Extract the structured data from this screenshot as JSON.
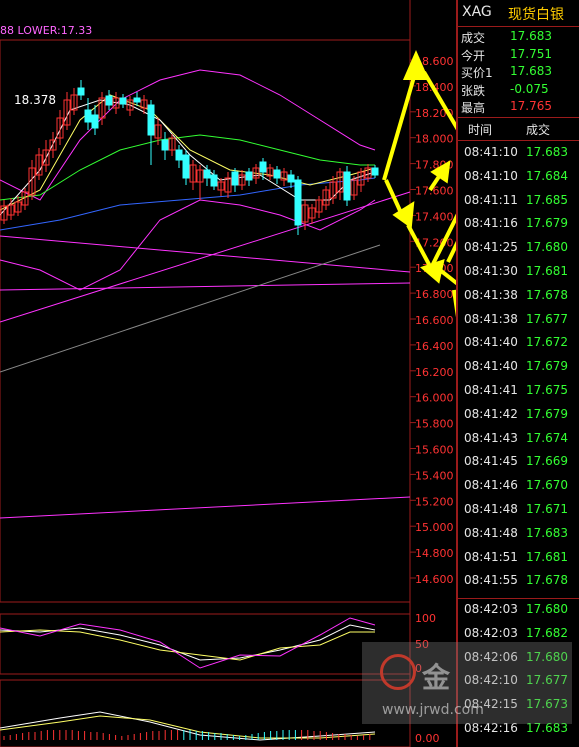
{
  "indicator_label": "88  LOWER:17.33",
  "high_label": "18.378",
  "price_axis": [
    "18.600",
    "18.400",
    "18.200",
    "18.000",
    "17.800",
    "17.600",
    "17.400",
    "17.200",
    "17.000",
    "16.800",
    "16.600",
    "16.400",
    "16.200",
    "16.000",
    "15.800",
    "15.600",
    "15.400",
    "15.200",
    "15.000",
    "14.800",
    "14.600"
  ],
  "kdj_axis": [
    "100",
    "50",
    "0"
  ],
  "macd_axis": [
    "0.00"
  ],
  "quote": {
    "symbol": "XAG",
    "name": "现货白银",
    "rows": [
      {
        "label": "成交",
        "value": "17.683",
        "color": "#33ff33"
      },
      {
        "label": "今开",
        "value": "17.751",
        "color": "#33ff33"
      },
      {
        "label": "买价1",
        "value": "17.683",
        "color": "#33ff33"
      },
      {
        "label": "张跌",
        "value": "-0.075",
        "color": "#33ff33"
      },
      {
        "label": "最高",
        "value": "17.765",
        "color": "#ff3333"
      }
    ]
  },
  "ticks_header": {
    "time": "时间",
    "deal": "成交"
  },
  "ticks": [
    {
      "time": "08:41:10",
      "price": "17.683"
    },
    {
      "time": "08:41:10",
      "price": "17.684"
    },
    {
      "time": "08:41:11",
      "price": "17.685"
    },
    {
      "time": "08:41:16",
      "price": "17.679"
    },
    {
      "time": "08:41:25",
      "price": "17.680"
    },
    {
      "time": "08:41:30",
      "price": "17.681"
    },
    {
      "time": "08:41:38",
      "price": "17.678"
    },
    {
      "time": "08:41:38",
      "price": "17.677"
    },
    {
      "time": "08:41:40",
      "price": "17.672"
    },
    {
      "time": "08:41:40",
      "price": "17.679"
    },
    {
      "time": "08:41:41",
      "price": "17.675"
    },
    {
      "time": "08:41:42",
      "price": "17.679"
    },
    {
      "time": "08:41:43",
      "price": "17.674"
    },
    {
      "time": "08:41:45",
      "price": "17.669"
    },
    {
      "time": "08:41:46",
      "price": "17.670"
    },
    {
      "time": "08:41:48",
      "price": "17.671"
    },
    {
      "time": "08:41:48",
      "price": "17.683"
    },
    {
      "time": "08:41:51",
      "price": "17.681"
    },
    {
      "time": "08:41:55",
      "price": "17.678"
    },
    {
      "time": "08:42:03",
      "price": "17.680"
    },
    {
      "time": "08:42:03",
      "price": "17.682"
    },
    {
      "time": "08:42:06",
      "price": "17.680"
    },
    {
      "time": "08:42:10",
      "price": "17.677"
    },
    {
      "time": "08:42:15",
      "price": "17.673"
    },
    {
      "time": "08:42:16",
      "price": "17.683"
    }
  ],
  "watermark": {
    "text": "金",
    "url": "www.jrwd.com"
  },
  "colors": {
    "up": "#ff3333",
    "down": "#33ffff",
    "ma5": "#ffffff",
    "ma10": "#ffff66",
    "ma20": "#33ff33",
    "ma60": "#3366ff",
    "boll": "#ff33ff",
    "arrow": "#ffff00",
    "grid": "#9b1b1b"
  }
}
